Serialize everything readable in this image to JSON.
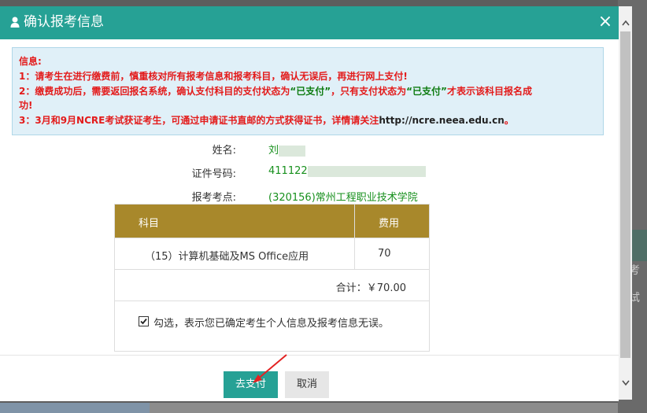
{
  "modal": {
    "title": "确认报考信息",
    "close_glyph": "×"
  },
  "notice": {
    "heading": "信息:",
    "line1": "1：请考生在进行缴费前，慎重核对所有报考信息和报考科目，确认无误后，再进行网上支付!",
    "line2_a": "2：缴费成功后，需要返回报名系统，确认支付科目的支付状态为",
    "line2_b": "“已支付”",
    "line2_c": "，只有支付状态为",
    "line2_d": "“已支付”",
    "line2_e": "才表示该科目报名成",
    "line2_f": "功!",
    "line3_a": "3：3月和9月NCRE考试获证考生，可通过申请证书直邮的方式获得证书，详情请关注",
    "line3_b": "http://ncre.neea.edu.cn",
    "line3_c": "。"
  },
  "candidate": {
    "name_label": "姓名:",
    "name_value": "刘",
    "id_label": "证件号码:",
    "id_value": "411122",
    "center_label": "报考考点:",
    "center_value": "(320156)常州工程职业技术学院"
  },
  "fee_table": {
    "col_subject": "科目",
    "col_fee": "费用",
    "rows": [
      {
        "subject": "（15）计算机基础及MS Office应用",
        "fee": "70"
      }
    ],
    "total": "合计：￥70.00",
    "confirm_text": "勾选，表示您已确定考生个人信息及报考信息无误。",
    "confirmed": true
  },
  "buttons": {
    "pay": "去支付",
    "cancel": "取消"
  },
  "backdrop": {
    "side_text": "考",
    "side_text2": "试"
  },
  "colors": {
    "header": "#26a195",
    "table_header": "#a8882b",
    "notice_red": "#e31b1b",
    "notice_green": "#0d7b10",
    "value_green": "#17901d"
  }
}
